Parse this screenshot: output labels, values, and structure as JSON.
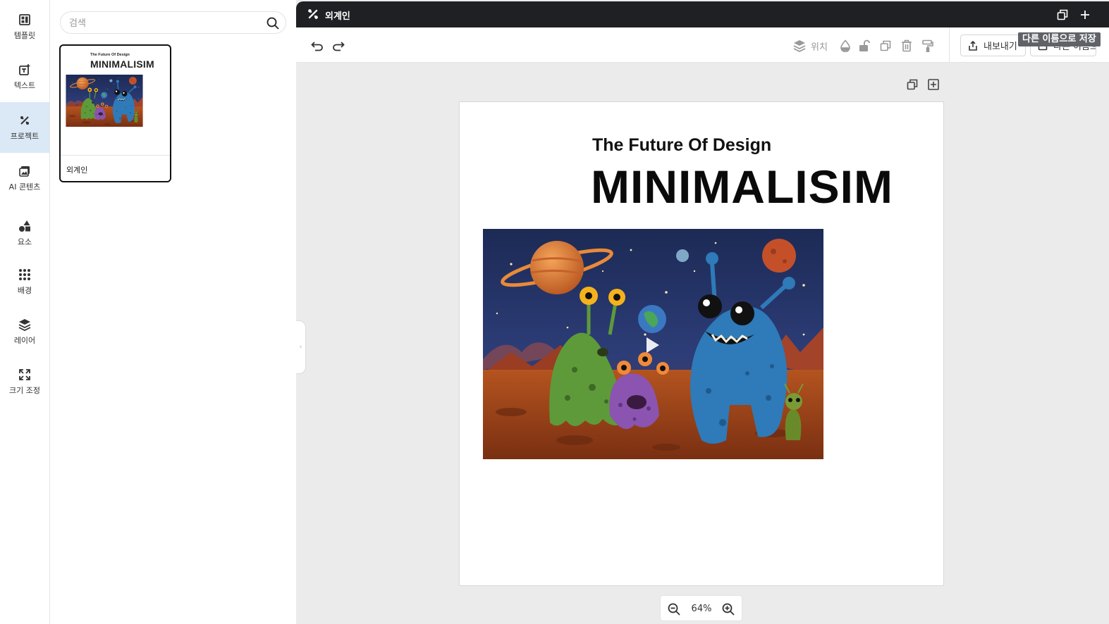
{
  "sidebar": {
    "items": [
      {
        "label": "템플릿",
        "icon": "template-icon"
      },
      {
        "label": "텍스트",
        "icon": "text-add-icon"
      },
      {
        "label": "프로젝트",
        "icon": "project-icon",
        "active": true
      },
      {
        "label": "AI 콘텐츠",
        "icon": "ai-content-icon"
      },
      {
        "label": "요소",
        "icon": "elements-icon"
      },
      {
        "label": "배경",
        "icon": "background-grid-icon"
      },
      {
        "label": "레이어",
        "icon": "layers-icon"
      },
      {
        "label": "크기 조정",
        "icon": "resize-icon"
      }
    ]
  },
  "panel": {
    "search_placeholder": "검색",
    "projects": [
      {
        "name": "외계인",
        "thumb_subtitle": "The Future Of Design",
        "thumb_title": "MINIMALISIM"
      }
    ]
  },
  "editor": {
    "title": "외계인",
    "toolbar": {
      "position_label": "위치",
      "export_label": "내보내기",
      "save_as_label": "다른 이름으로 저장",
      "save_as_button_text": "다른 이름으로 저장"
    },
    "tooltip": "다른 이름으로 저장",
    "canvas": {
      "subtitle": "The Future Of Design",
      "title": "MINIMALISIM"
    },
    "zoom": "64%"
  },
  "colors": {
    "titlebar_bg": "#1f2023",
    "active_nav_bg": "#dbe8f5",
    "workspace_bg": "#ebebeb"
  }
}
